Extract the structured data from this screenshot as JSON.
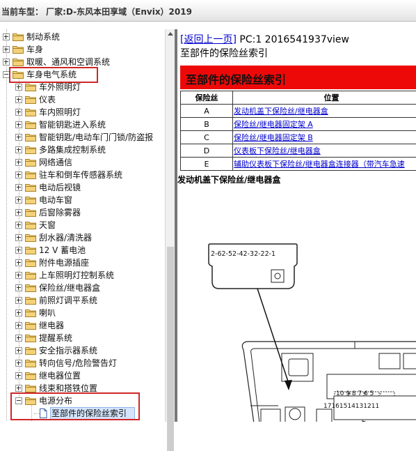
{
  "window": {
    "title": "当前车型： 厂家:D-东风本田享域（Envix）2019"
  },
  "tree": {
    "items": [
      {
        "label": "制动系统",
        "level": 0,
        "expanded": false
      },
      {
        "label": "车身",
        "level": 0,
        "expanded": false
      },
      {
        "label": "取暖、通风和空调系统",
        "level": 0,
        "expanded": false
      },
      {
        "label": "车身电气系统",
        "level": 0,
        "expanded": true
      },
      {
        "label": "车外照明灯",
        "level": 1
      },
      {
        "label": "仪表",
        "level": 1
      },
      {
        "label": "车内照明灯",
        "level": 1
      },
      {
        "label": "智能钥匙进入系统",
        "level": 1
      },
      {
        "label": "智能钥匙/电动车门门锁/防盗报",
        "level": 1
      },
      {
        "label": "多路集成控制系统",
        "level": 1
      },
      {
        "label": "网络通信",
        "level": 1
      },
      {
        "label": "驻车和倒车传感器系统",
        "level": 1
      },
      {
        "label": "电动后视镜",
        "level": 1
      },
      {
        "label": "电动车窗",
        "level": 1
      },
      {
        "label": "后窗除雾器",
        "level": 1
      },
      {
        "label": "天窗",
        "level": 1
      },
      {
        "label": "刮水器/清洗器",
        "level": 1
      },
      {
        "label": "12 V 蓄电池",
        "level": 1
      },
      {
        "label": "附件电源插座",
        "level": 1
      },
      {
        "label": "上车照明灯控制系统",
        "level": 1
      },
      {
        "label": "保险丝/继电器盒",
        "level": 1
      },
      {
        "label": "前照灯调平系统",
        "level": 1
      },
      {
        "label": "喇叭",
        "level": 1
      },
      {
        "label": "继电器",
        "level": 1
      },
      {
        "label": "提醒系统",
        "level": 1
      },
      {
        "label": "安全指示器系统",
        "level": 1
      },
      {
        "label": "转向信号/危险警告灯",
        "level": 1
      },
      {
        "label": "继电器位置",
        "level": 1
      },
      {
        "label": "线束和搭铁位置",
        "level": 1
      },
      {
        "label": "电源分布",
        "level": 1,
        "expanded": true
      },
      {
        "label": "至部件的保险丝索引",
        "level": 2,
        "selected": true
      }
    ]
  },
  "content": {
    "back_link": "[返回上一页]",
    "pc_text": " PC:1 2016541937view",
    "subtitle": "至部件的保险丝索引",
    "banner_title": "至部件的保险丝索引",
    "table": {
      "headers": [
        "保险丝",
        "位置"
      ],
      "rows": [
        [
          "A",
          "发动机盖下保险丝/继电器盒"
        ],
        [
          "B",
          "保险丝/继电器固定架 A"
        ],
        [
          "C",
          "保险丝/继电器固定架 B"
        ],
        [
          "D",
          "仪表板下保险丝/继电器盒"
        ],
        [
          "E",
          "辅助仪表板下保险丝/继电器盒连接器（带汽车急速"
        ]
      ]
    },
    "section_title": "发动机盖下保险丝/继电器盒",
    "connector_pins": [
      "2-6",
      "2-5",
      "2-4",
      "2-3",
      "2-2",
      "2-1"
    ],
    "fuse_numbers_top": [
      "10",
      "9",
      "8",
      "7",
      "6",
      "5"
    ],
    "fuse_numbers_bottom": [
      "17",
      "16",
      "15",
      "14",
      "13",
      "12",
      "11"
    ]
  },
  "colors": {
    "banner": "#ee0909",
    "link": "#0000cc",
    "highlight_box": "#d02626"
  }
}
